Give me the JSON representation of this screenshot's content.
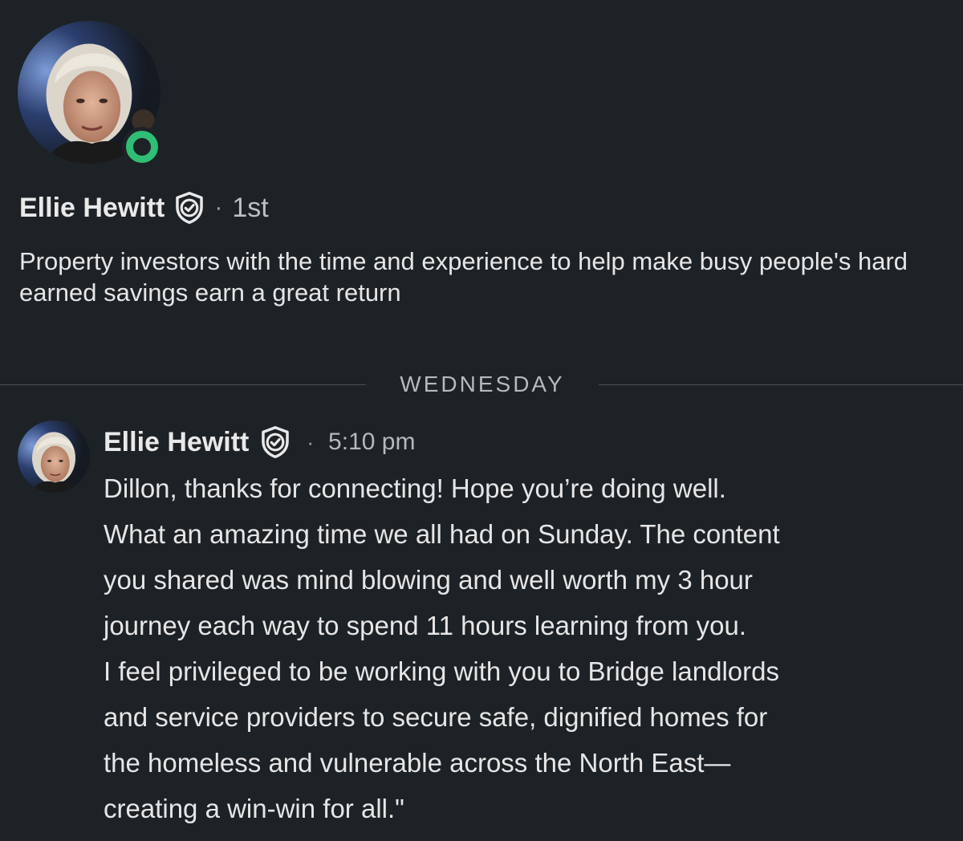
{
  "profile": {
    "avatar_icon": "profile-photo",
    "online_status_color": "#2fbe74",
    "name": "Ellie Hewitt",
    "verified_icon": "verified-shield-icon",
    "separator": "·",
    "connection_degree": "1st",
    "headline": "Property investors with the time and experience to help make busy people's hard earned savings earn a great return"
  },
  "divider": {
    "label": "WEDNESDAY"
  },
  "message": {
    "sender": "Ellie Hewitt",
    "separator": "·",
    "time": "5:10 pm",
    "lines": [
      "Dillon, thanks for connecting! Hope you’re doing well.",
      "What an amazing time we all had on Sunday. The content",
      "you shared was mind blowing and well worth my 3 hour",
      "journey each way to spend 11 hours learning from you.",
      "I feel privileged to be working with you to Bridge landlords",
      "and service providers to secure safe, dignified homes for",
      "the homeless and vulnerable across the North East—",
      "creating a win-win for all.\""
    ]
  },
  "colors": {
    "background": "#1d2226",
    "text": "#e9e9e9",
    "muted": "#b6b9bb",
    "online": "#2fbe74"
  }
}
